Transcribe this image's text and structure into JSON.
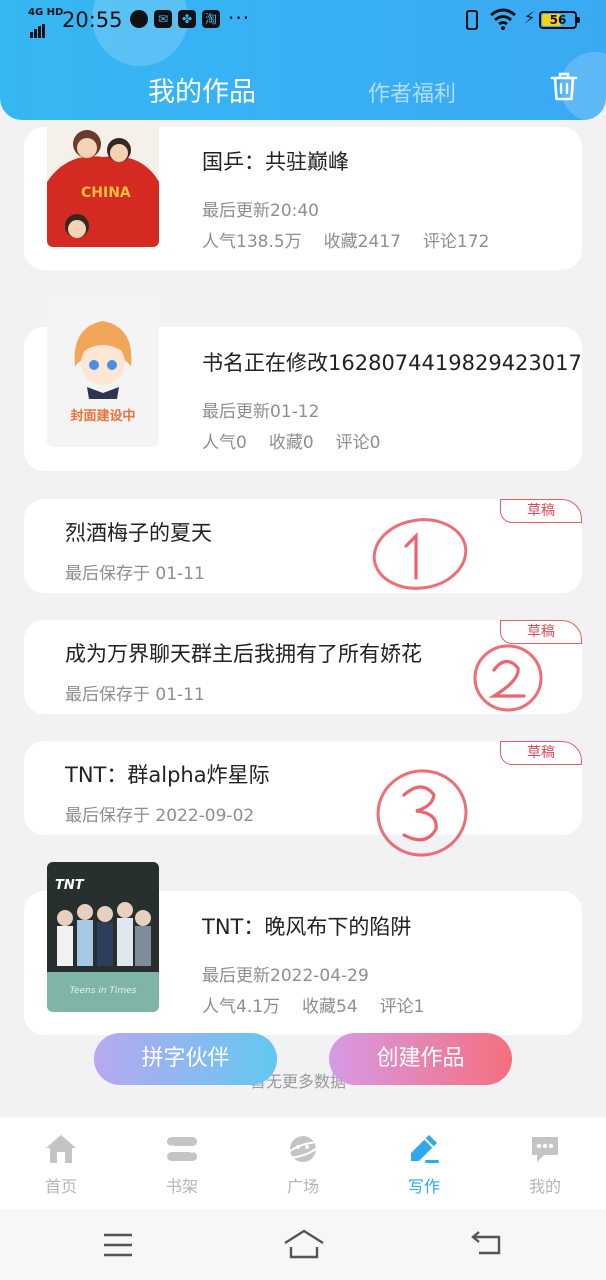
{
  "status_bar": {
    "network": "4G HD",
    "time": "20:55",
    "battery": "56",
    "overflow": "···",
    "app_icons": [
      "browser-icon",
      "mail-icon",
      "fan-icon",
      "taobao-icon"
    ],
    "taobao_glyph": "淘"
  },
  "header": {
    "tab_active": "我的作品",
    "tab_inactive": "作者福利"
  },
  "works": [
    {
      "title": "国乒：共驻巅峰",
      "updated": "最后更新20:40",
      "popularity": "人气138.5万",
      "favorites": "收藏2417",
      "comments": "评论172",
      "cover": "china-cover"
    },
    {
      "title": "书名正在修改1628074419829423017",
      "updated": "最后更新01-12",
      "popularity": "人气0",
      "favorites": "收藏0",
      "comments": "评论0",
      "cover": "placeholder-cover",
      "cover_caption": "封面建设中"
    },
    {
      "title": "TNT：晚风布下的陷阱",
      "updated": "最后更新2022-04-29",
      "popularity": "人气4.1万",
      "favorites": "收藏54",
      "comments": "评论1",
      "cover": "tnt-cover",
      "cover_caption_top": "TNT",
      "cover_caption_bottom": "Teens in Times"
    }
  ],
  "drafts": [
    {
      "title": "烈酒梅子的夏天",
      "saved": "最后保存于 01-11",
      "badge": "草稿",
      "annotation": "1"
    },
    {
      "title": "成为万界聊天群主后我拥有了所有娇花",
      "saved": "最后保存于 01-11",
      "badge": "草稿",
      "annotation": "2"
    },
    {
      "title": "TNT：群alpha炸星际",
      "saved": "最后保存于 2022-09-02",
      "badge": "草稿",
      "annotation": "3"
    }
  ],
  "footer": {
    "end_text": "暂无更多数据",
    "left_button": "拼字伙伴",
    "right_button": "创建作品"
  },
  "bottom_nav": [
    {
      "label": "首页",
      "icon": "home-icon"
    },
    {
      "label": "书架",
      "icon": "bookshelf-icon"
    },
    {
      "label": "广场",
      "icon": "planet-icon"
    },
    {
      "label": "写作",
      "icon": "pen-icon",
      "active": true
    },
    {
      "label": "我的",
      "icon": "chat-bubble-icon"
    }
  ],
  "colors": {
    "header": "#38b0f5",
    "accent": "#2fa8ee",
    "draft_badge": "#e55f6b",
    "annotation": "#e84a55"
  }
}
